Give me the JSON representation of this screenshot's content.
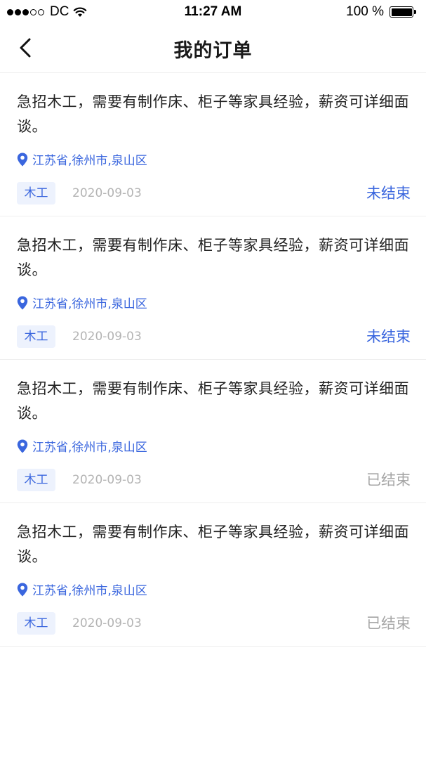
{
  "status_bar": {
    "carrier": "DC",
    "time": "11:27 AM",
    "battery_percent": "100 %",
    "signal_bars_filled": 3,
    "signal_bars_total": 5,
    "wifi_icon": "wifi-icon",
    "battery_icon": "battery-icon"
  },
  "nav": {
    "back_icon": "chevron-left-icon",
    "title": "我的订单"
  },
  "colors": {
    "accent": "#3a66de",
    "tag_background": "#edf2fd",
    "closed_status": "#a6a6a6",
    "date": "#b4b4b4",
    "divider": "#eeeeee"
  },
  "orders": [
    {
      "description": "急招木工，需要有制作床、柜子等家具经验，薪资可详细面谈。",
      "location": "江苏省,徐州市,泉山区",
      "location_icon": "map-pin-icon",
      "tag": "木工",
      "date": "2020-09-03",
      "status": "未结束",
      "status_type": "open"
    },
    {
      "description": "急招木工，需要有制作床、柜子等家具经验，薪资可详细面谈。",
      "location": "江苏省,徐州市,泉山区",
      "location_icon": "map-pin-icon",
      "tag": "木工",
      "date": "2020-09-03",
      "status": "未结束",
      "status_type": "open"
    },
    {
      "description": "急招木工，需要有制作床、柜子等家具经验，薪资可详细面谈。",
      "location": "江苏省,徐州市,泉山区",
      "location_icon": "map-pin-icon",
      "tag": "木工",
      "date": "2020-09-03",
      "status": "已结束",
      "status_type": "closed"
    },
    {
      "description": "急招木工，需要有制作床、柜子等家具经验，薪资可详细面谈。",
      "location": "江苏省,徐州市,泉山区",
      "location_icon": "map-pin-icon",
      "tag": "木工",
      "date": "2020-09-03",
      "status": "已结束",
      "status_type": "closed"
    }
  ]
}
